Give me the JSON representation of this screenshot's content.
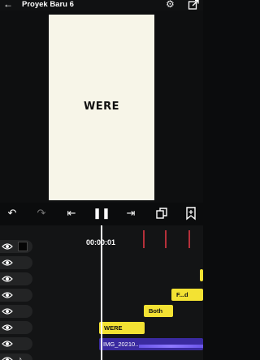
{
  "header": {
    "title": "Proyek Baru 6",
    "back_icon": "arrow-left-icon",
    "settings_icon": "gear-icon",
    "export_icon": "export-icon"
  },
  "preview": {
    "canvas_text": "WERE",
    "canvas_color": "#f7f5e8"
  },
  "controls": {
    "icons": [
      "undo-icon",
      "redo-icon",
      "skip-to-start-icon",
      "pause-icon",
      "skip-to-end-icon",
      "loop-icon",
      "bookmark-icon"
    ]
  },
  "timeline": {
    "time": "00:00:01",
    "clips": {
      "were": "WERE",
      "both": "Both",
      "fd": "F...d",
      "video": "IMG_20210..."
    },
    "colors": {
      "text_clip": "#f3e233",
      "video_clip": "#3a2aa0",
      "marker": "#b5303a"
    }
  }
}
